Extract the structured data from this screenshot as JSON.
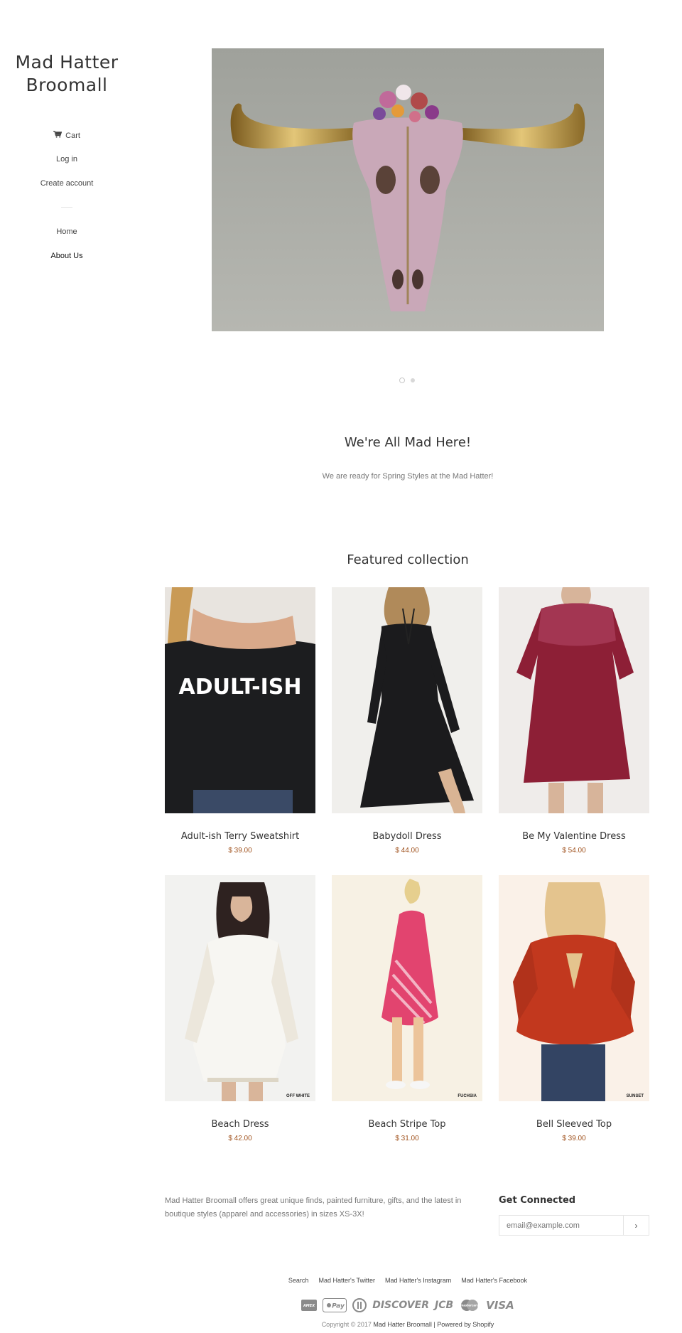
{
  "site": {
    "title": "Mad Hatter Broomall"
  },
  "nav": {
    "cart": "Cart",
    "login": "Log in",
    "create_account": "Create account",
    "home": "Home",
    "about": "About Us"
  },
  "rich_text": {
    "heading": "We're All Mad Here!",
    "body": "We are ready for Spring Styles at the Mad Hatter!"
  },
  "featured": {
    "heading": "Featured collection",
    "products": [
      {
        "title": "Adult-ish Terry Sweatshirt",
        "price": "$ 39.00",
        "image_text": "ADULT-ISH"
      },
      {
        "title": "Babydoll Dress",
        "price": "$ 44.00"
      },
      {
        "title": "Be My Valentine Dress",
        "price": "$ 54.00"
      },
      {
        "title": "Beach Dress",
        "price": "$ 42.00",
        "image_tag": "OFF WHITE"
      },
      {
        "title": "Beach Stripe Top",
        "price": "$ 31.00",
        "image_tag": "FUCHSIA"
      },
      {
        "title": "Bell Sleeved Top",
        "price": "$ 39.00",
        "image_tag": "SUNSET"
      }
    ]
  },
  "footer": {
    "about": "Mad Hatter Broomall offers great unique finds, painted furniture, gifts, and the latest in boutique styles (apparel and accessories) in sizes XS-3X!",
    "connect_heading": "Get Connected",
    "email_placeholder": "email@example.com",
    "submit_glyph": "›",
    "links": [
      "Search",
      "Mad Hatter's Twitter",
      "Mad Hatter's Instagram",
      "Mad Hatter's Facebook"
    ],
    "payments": [
      "AMEX",
      "Pay",
      "DISC",
      "DISCOVER",
      "JCB",
      "mastercard",
      "VISA"
    ],
    "copyright_prefix": "Copyright © 2017",
    "copyright_shop": "Mad Hatter Broomall",
    "copyright_suffix": "| Powered by Shopify"
  },
  "colors": {
    "accent_price": "#a0521e",
    "text": "#333333",
    "muted": "#777777"
  },
  "icons": {
    "cart": "cart-icon",
    "submit": "chevron-right-icon"
  }
}
